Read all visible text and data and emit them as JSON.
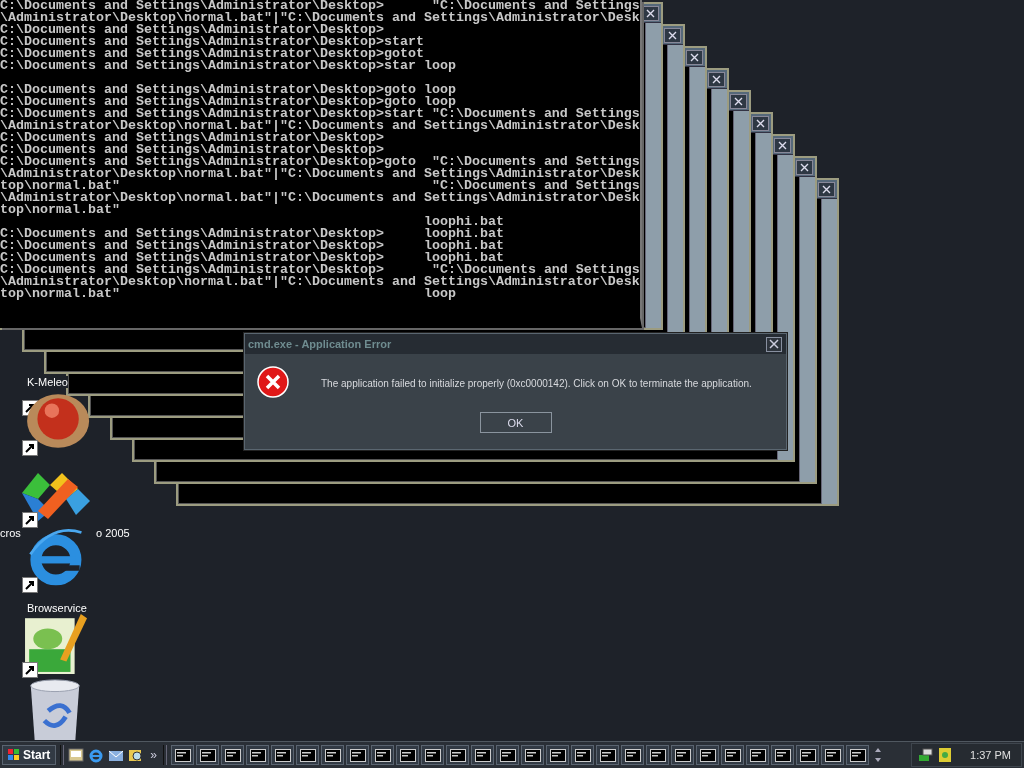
{
  "console": {
    "blocks": [
      [
        "C:\\Documents and Settings\\Administrator\\Desktop>      \"C:\\Documents and Settings",
        "\\Administrator\\Desktop\\normal.bat\"|\"C:\\Documents and Settings\\Administrator\\Desk",
        "C:\\Documents and Settings\\Administrator\\Desktop>",
        "C:\\Documents and Settings\\Administrator\\Desktop>start",
        "C:\\Documents and Settings\\Administrator\\Desktop>gotot",
        "C:\\Documents and Settings\\Administrator\\Desktop>star loop"
      ],
      [
        "C:\\Documents and Settings\\Administrator\\Desktop>goto loop",
        "C:\\Documents and Settings\\Administrator\\Desktop>goto loop",
        "C:\\Documents and Settings\\Administrator\\Desktop>start \"C:\\Documents and Settings",
        "\\Administrator\\Desktop\\normal.bat\"|\"C:\\Documents and Settings\\Administrator\\Desk",
        "C:\\Documents and Settings\\Administrator\\Desktop>",
        "C:\\Documents and Settings\\Administrator\\Desktop>",
        "C:\\Documents and Settings\\Administrator\\Desktop>goto  \"C:\\Documents and Settings",
        "\\Administrator\\Desktop\\normal.bat\"|\"C:\\Documents and Settings\\Administrator\\Desk",
        "top\\normal.bat\"                                       \"C:\\Documents and Settings",
        "\\Administrator\\Desktop\\normal.bat\"|\"C:\\Documents and Settings\\Administrator\\Desk",
        "top\\normal.bat\"",
        "                                                     loophi.bat",
        "C:\\Documents and Settings\\Administrator\\Desktop>     loophi.bat",
        "C:\\Documents and Settings\\Administrator\\Desktop>     loophi.bat",
        "C:\\Documents and Settings\\Administrator\\Desktop>     loophi.bat",
        "C:\\Documents and Settings\\Administrator\\Desktop>      \"C:\\Documents and Settings",
        "\\Administrator\\Desktop\\normal.bat\"|\"C:\\Documents and Settings\\Administrator\\Desk",
        "top\\normal.bat\"                                      loop"
      ]
    ]
  },
  "desktop_icons": [
    {
      "kind": "hidden",
      "shortcut": true,
      "label": "K-Meleo"
    },
    {
      "kind": "ball",
      "shortcut": true
    },
    {
      "kind": "knot",
      "shortcut": true,
      "label_parts": [
        "cros",
        "o 2005"
      ]
    },
    {
      "kind": "browser",
      "shortcut": true,
      "label": "Browservice"
    },
    {
      "kind": "notepad",
      "shortcut": true
    },
    {
      "kind": "trash",
      "shortcut": false
    }
  ],
  "dialog": {
    "title": "cmd.exe - Application Error",
    "message": "The application failed to initialize properly (0xc0000142). Click on OK to terminate the application.",
    "button": "OK"
  },
  "taskbar": {
    "start": "Start",
    "quick_launch": [
      {
        "kind": "desktop"
      },
      {
        "kind": "browser"
      },
      {
        "kind": "mail"
      },
      {
        "kind": "search"
      }
    ],
    "more": "»",
    "tasks": [
      {
        "kind": "console"
      },
      {
        "kind": "console"
      },
      {
        "kind": "console"
      },
      {
        "kind": "console"
      },
      {
        "kind": "console"
      },
      {
        "kind": "console"
      },
      {
        "kind": "console"
      },
      {
        "kind": "console"
      },
      {
        "kind": "console"
      },
      {
        "kind": "console"
      },
      {
        "kind": "console"
      },
      {
        "kind": "console"
      },
      {
        "kind": "console"
      },
      {
        "kind": "console"
      },
      {
        "kind": "console"
      },
      {
        "kind": "console"
      },
      {
        "kind": "console"
      },
      {
        "kind": "console"
      },
      {
        "kind": "console"
      },
      {
        "kind": "console"
      },
      {
        "kind": "console"
      },
      {
        "kind": "console"
      },
      {
        "kind": "console"
      },
      {
        "kind": "console"
      },
      {
        "kind": "console"
      },
      {
        "kind": "console"
      },
      {
        "kind": "console"
      },
      {
        "kind": "console"
      }
    ],
    "clock": "1:37 PM"
  }
}
